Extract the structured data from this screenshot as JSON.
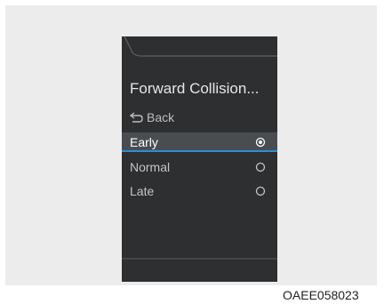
{
  "screen": {
    "title": "Forward Collision...",
    "back_label": "Back",
    "options": [
      {
        "label": "Early",
        "selected": true
      },
      {
        "label": "Normal",
        "selected": false
      },
      {
        "label": "Late",
        "selected": false
      }
    ]
  },
  "caption": "OAEE058023",
  "colors": {
    "screen_bg": "#2e2f31",
    "highlight": "#4a4d50",
    "accent": "#2a8fd8"
  }
}
